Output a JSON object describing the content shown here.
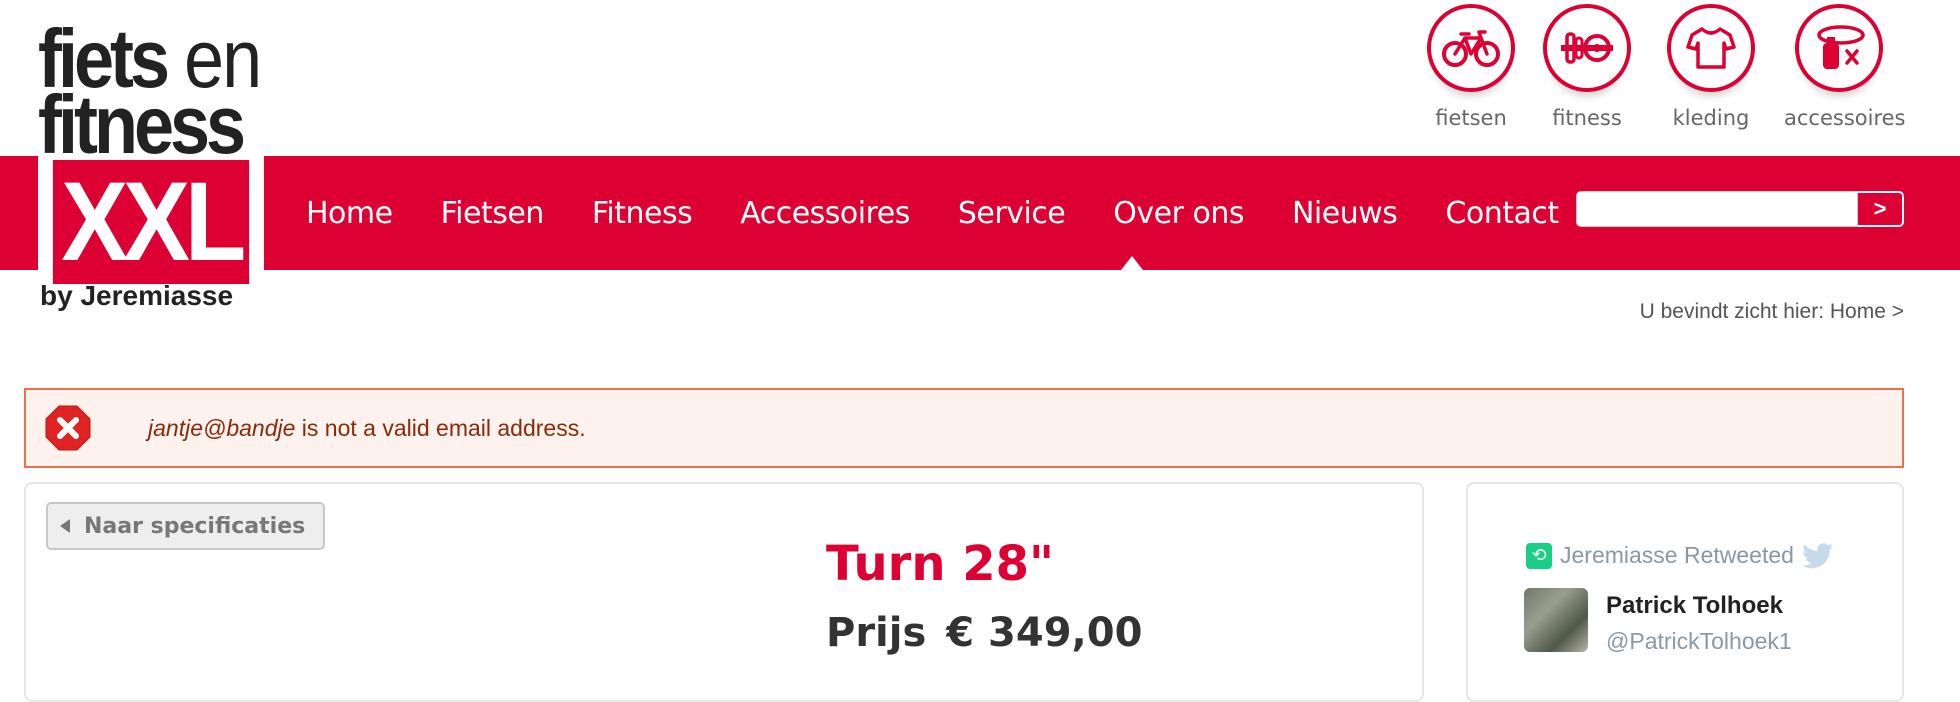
{
  "logo": {
    "line1_main": "fiets",
    "line1_en": " en",
    "line2": "fitness",
    "xxl": "XXL",
    "by": "by Jeremiasse"
  },
  "categories": [
    {
      "label": "fietsen",
      "icon": "bicycle-icon"
    },
    {
      "label": "fitness",
      "icon": "fitness-icon"
    },
    {
      "label": "kleding",
      "icon": "tshirt-icon"
    },
    {
      "label": "accessoires",
      "icon": "accessories-icon"
    }
  ],
  "nav": {
    "items": [
      "Home",
      "Fietsen",
      "Fitness",
      "Accessoires",
      "Service",
      "Over ons",
      "Nieuws",
      "Contact"
    ],
    "active": "Over ons"
  },
  "search": {
    "value": "",
    "button_label": ">"
  },
  "breadcrumb": {
    "text": "U bevindt zicht hier: Home >"
  },
  "alert": {
    "email": "jantje@bandje",
    "message": " is not a valid email address."
  },
  "product": {
    "back_label": "Naar specificaties",
    "title": "Turn 28\"",
    "price_label": "Prijs",
    "price_value": "€ 349,00"
  },
  "twitter": {
    "retweet_text": "Jeremiasse Retweeted",
    "name": "Patrick Tolhoek",
    "handle": "@PatrickTolhoek1"
  },
  "colors": {
    "brand_red": "#dd0033",
    "alert_border": "#e8734a",
    "alert_bg": "#fdf2ee",
    "twitter_gray": "#8899a6",
    "retweet_green": "#19cf86"
  }
}
